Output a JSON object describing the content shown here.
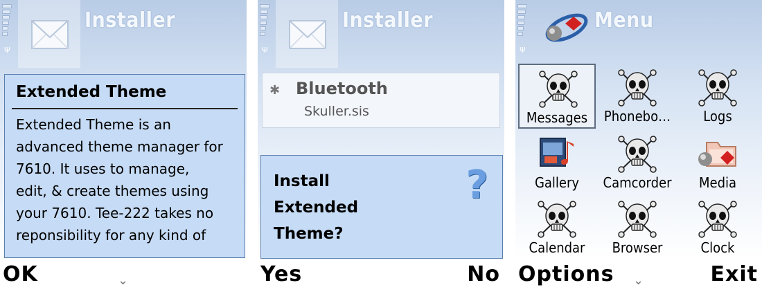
{
  "screens": [
    {
      "title": "Installer",
      "panel_title": "Extended Theme",
      "body_lines": [
        "Extended Theme is an",
        "advanced theme manager for",
        "7610. It uses to manage,",
        "edit, & create themes using",
        "your 7610. Tee-222 takes no",
        "reponsibility for any kind of"
      ],
      "softkey_left": "OK",
      "softkey_middle": "⌄"
    },
    {
      "title": "Installer",
      "item_title": "Bluetooth",
      "item_subtitle": "Skuller.sis",
      "query_lines": [
        "Install",
        "Extended",
        "Theme?"
      ],
      "query_icon": "?",
      "softkey_left": "Yes",
      "softkey_right": "No"
    },
    {
      "title": "Menu",
      "apps": [
        {
          "label": "Messages",
          "icon": "skull-icon",
          "selected": true
        },
        {
          "label": "Phonebo…",
          "icon": "skull-icon"
        },
        {
          "label": "Logs",
          "icon": "skull-icon"
        },
        {
          "label": "Gallery",
          "icon": "gallery-icon"
        },
        {
          "label": "Camcorder",
          "icon": "skull-icon"
        },
        {
          "label": "Media",
          "icon": "media-icon"
        },
        {
          "label": "Calendar",
          "icon": "skull-icon"
        },
        {
          "label": "Browser",
          "icon": "skull-icon"
        },
        {
          "label": "Clock",
          "icon": "skull-icon"
        }
      ],
      "softkey_left": "Options",
      "softkey_middle": "⌄",
      "softkey_right": "Exit"
    }
  ],
  "colors": {
    "panel_bg": "#c6dbf5",
    "title_text": "#f4f8fc",
    "query_icon": "#6a9ee0"
  }
}
